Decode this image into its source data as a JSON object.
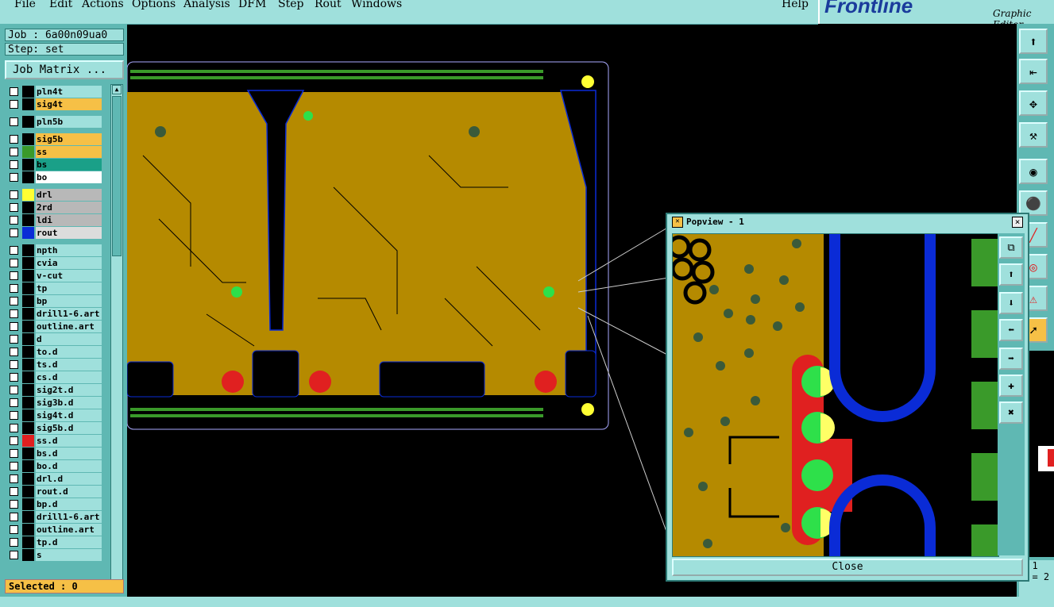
{
  "menu": {
    "items": [
      "File",
      "Edit",
      "Actions",
      "Options",
      "Analysis",
      "DFM",
      "Step",
      "Rout",
      "Windows"
    ],
    "help": "Help"
  },
  "brand": {
    "logo": "Frontline",
    "subtitle": "Graphic Editor"
  },
  "job": {
    "job_label": "Job : 6a00n09ua0",
    "step_label": "Step: set",
    "job_matrix_button": "Job Matrix ..."
  },
  "layers": [
    {
      "name": "pln4t",
      "swatch": "#000000",
      "name_bg": "#9fe0dc"
    },
    {
      "name": "sig4t",
      "swatch": "#000000",
      "name_bg": "#f6c046"
    },
    {
      "name": "pln5b",
      "swatch": "#000000",
      "name_bg": "#9fe0dc"
    },
    {
      "name": "sig5b",
      "swatch": "#000000",
      "name_bg": "#f6c046"
    },
    {
      "name": "ss",
      "swatch": "#3a9a2a",
      "name_bg": "#f6c046"
    },
    {
      "name": "bs",
      "swatch": "#000000",
      "name_bg": "#1aa088"
    },
    {
      "name": "bo",
      "swatch": "#000000",
      "name_bg": "#ffffff"
    },
    {
      "name": "drl",
      "swatch": "#ffff33",
      "name_bg": "#b8b8b8"
    },
    {
      "name": "2rd",
      "swatch": "#000000",
      "name_bg": "#b8b8b8"
    },
    {
      "name": "ldi",
      "swatch": "#000000",
      "name_bg": "#b8b8b8"
    },
    {
      "name": "rout",
      "swatch": "#0a2bd6",
      "name_bg": "#dcdcdc"
    },
    {
      "name": "npth",
      "swatch": "#000000",
      "name_bg": "#9fe0dc"
    },
    {
      "name": "cvia",
      "swatch": "#000000",
      "name_bg": "#9fe0dc"
    },
    {
      "name": "v-cut",
      "swatch": "#000000",
      "name_bg": "#9fe0dc"
    },
    {
      "name": "tp",
      "swatch": "#000000",
      "name_bg": "#9fe0dc"
    },
    {
      "name": "bp",
      "swatch": "#000000",
      "name_bg": "#9fe0dc"
    },
    {
      "name": "drill1-6.art",
      "swatch": "#000000",
      "name_bg": "#9fe0dc"
    },
    {
      "name": "outline.art",
      "swatch": "#000000",
      "name_bg": "#9fe0dc"
    },
    {
      "name": "d",
      "swatch": "#000000",
      "name_bg": "#9fe0dc"
    },
    {
      "name": "to.d",
      "swatch": "#000000",
      "name_bg": "#9fe0dc"
    },
    {
      "name": "ts.d",
      "swatch": "#000000",
      "name_bg": "#9fe0dc"
    },
    {
      "name": "cs.d",
      "swatch": "#000000",
      "name_bg": "#9fe0dc"
    },
    {
      "name": "sig2t.d",
      "swatch": "#000000",
      "name_bg": "#9fe0dc"
    },
    {
      "name": "sig3b.d",
      "swatch": "#000000",
      "name_bg": "#9fe0dc"
    },
    {
      "name": "sig4t.d",
      "swatch": "#000000",
      "name_bg": "#9fe0dc"
    },
    {
      "name": "sig5b.d",
      "swatch": "#000000",
      "name_bg": "#9fe0dc"
    },
    {
      "name": "ss.d",
      "swatch": "#e02020",
      "name_bg": "#9fe0dc"
    },
    {
      "name": "bs.d",
      "swatch": "#000000",
      "name_bg": "#9fe0dc"
    },
    {
      "name": "bo.d",
      "swatch": "#000000",
      "name_bg": "#9fe0dc"
    },
    {
      "name": "drl.d",
      "swatch": "#000000",
      "name_bg": "#9fe0dc"
    },
    {
      "name": "rout.d",
      "swatch": "#000000",
      "name_bg": "#9fe0dc"
    },
    {
      "name": "bp.d",
      "swatch": "#000000",
      "name_bg": "#9fe0dc"
    },
    {
      "name": "drill1-6.art",
      "swatch": "#000000",
      "name_bg": "#9fe0dc"
    },
    {
      "name": "outline.art",
      "swatch": "#000000",
      "name_bg": "#9fe0dc"
    },
    {
      "name": "tp.d",
      "swatch": "#000000",
      "name_bg": "#9fe0dc"
    },
    {
      "name": "s",
      "swatch": "#000000",
      "name_bg": "#9fe0dc"
    }
  ],
  "selected_label": "Selected : 0",
  "popview": {
    "title": "Popview - 1",
    "close_button": "Close"
  },
  "coords": {
    "x_label": "=",
    "x_value": "1",
    "y_label": "Y =",
    "y_value": "2"
  },
  "colors": {
    "panel": "#5fb8b3",
    "panel_light": "#9fe0dc",
    "copper": "#b58a00",
    "highlight": "#f6c046",
    "rout": "#0a2bd6",
    "green_pad": "#3a9a2a",
    "via": "#2ee04a",
    "red": "#e02020"
  }
}
